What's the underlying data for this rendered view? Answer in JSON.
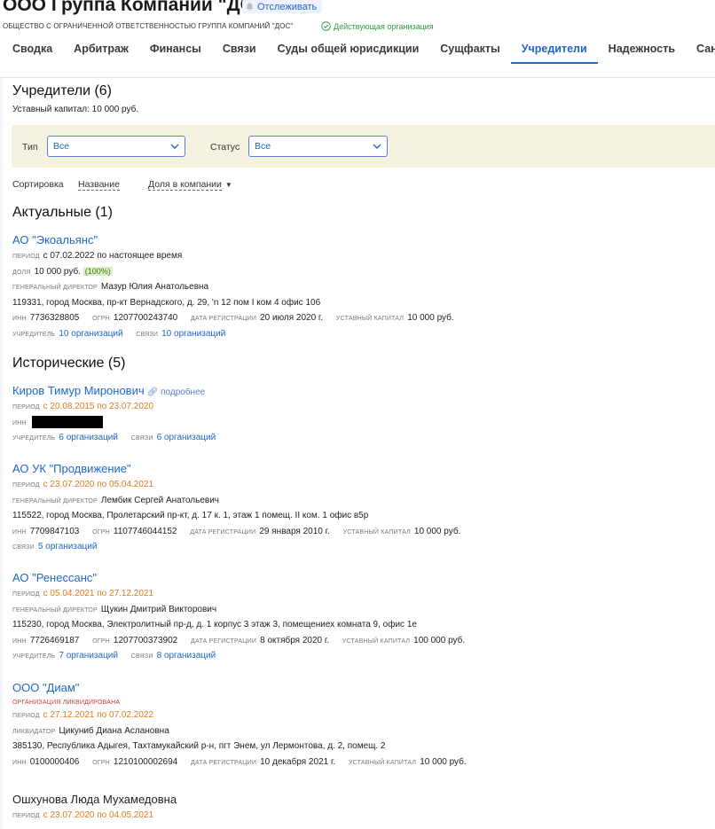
{
  "header": {
    "company_name": "ООО Группа Компаний \"ДОС\"",
    "track_label": "Отслеживать",
    "full_name": "ОБЩЕСТВО С ОГРАНИЧЕННОЙ ОТВЕТСТВЕННОСТЬЮ ГРУППА КОМПАНИЙ \"ДОС\"",
    "status": "Действующая организация",
    "status_color": "#2f9a48"
  },
  "tabs": [
    {
      "label": "Сводка"
    },
    {
      "label": "Арбитраж"
    },
    {
      "label": "Финансы"
    },
    {
      "label": "Связи"
    },
    {
      "label": "Суды общей юрисдикции"
    },
    {
      "label": "Сущфакты"
    },
    {
      "label": "Учредители"
    },
    {
      "label": "Надежность"
    },
    {
      "label": "Санкции"
    }
  ],
  "active_tab": "Учредители",
  "founders": {
    "title": "Учредители (6)",
    "capital": "Уставный капитал: 10 000 руб.",
    "filters": {
      "type_label": "Тип",
      "type_value": "Все",
      "status_label": "Статус",
      "status_value": "Все"
    },
    "sort": {
      "label": "Сортировка",
      "by_name": "Название",
      "by_share": "Доля в компании"
    },
    "current_title": "Актуальные (1)",
    "historical_title": "Исторические (5)"
  },
  "labels": {
    "period": "период",
    "share": "доля",
    "ceo": "генеральный директор",
    "liquidator": "ликвидатор",
    "inn": "инн",
    "ogrn": "огрн",
    "reg_date": "дата регистрации",
    "capital": "уставный капитал",
    "founder": "учредитель",
    "links": "связи",
    "more": "подробнее",
    "liquidated": "организация ликвидирована"
  },
  "current": [
    {
      "name": "АО \"Экоальянс\"",
      "period": "с 07.02.2022 по настоящее время",
      "share": "10 000 руб.",
      "share_pct": "(100%)",
      "ceo": "Мазур Юлия Анатольевна",
      "address": "119331, город Москва, пр-кт Вернадского, д. 29, 'n 12 пом I ком 4 офис 106",
      "inn": "7736328805",
      "ogrn": "1207700243740",
      "reg_date": "20 июля 2020 г.",
      "capital": "10 000 руб.",
      "founder": "10 организаций",
      "links": "10 организаций"
    }
  ],
  "historical": [
    {
      "name": "Киров Тимур Миронович",
      "period": "с 20.08.2015 по 23.07.2020",
      "founder": "6 организаций",
      "links": "6 организаций"
    },
    {
      "name": "АО УК \"Продвижение\"",
      "period": "с 23.07.2020 по 05.04.2021",
      "ceo": "Лембик Сергей Анатольевич",
      "address": "115522, город Москва, Пролетарский пр-кт, д. 17 к. 1, этаж 1 помещ. II ком. 1 офис в5р",
      "inn": "7709847103",
      "ogrn": "1107746044152",
      "reg_date": "29 января 2010 г.",
      "capital": "10 000 руб.",
      "links": "5 организаций"
    },
    {
      "name": "АО \"Ренессанс\"",
      "period": "с 05.04.2021 по 27.12.2021",
      "ceo": "Щукин Дмитрий Викторович",
      "address": "115230, город Москва, Электролитный пр-д, д. 1 корпус 3 этаж 3, помещениех комната 9, офис 1е",
      "inn": "7726469187",
      "ogrn": "1207700373902",
      "reg_date": "8 октября 2020 г.",
      "capital": "100 000 руб.",
      "founder": "7 организаций",
      "links": "8 организаций"
    },
    {
      "name": "ООО \"Диам\"",
      "period": "с 27.12.2021 по 07.02.2022",
      "liquidator": "Цикуниб Диана Аслановна",
      "address": "385130, Республика Адыгея, Тахтамукайский р-н, пгт Энем, ул Лермонтова, д. 2, помещ. 2",
      "inn": "0100000406",
      "ogrn": "1210100002694",
      "reg_date": "10 декабря 2021 г.",
      "capital": "10 000 руб."
    },
    {
      "name": "Ошхунова Люда Мухамедовна",
      "period": "с 23.07.2020 по 04.05.2021"
    }
  ]
}
